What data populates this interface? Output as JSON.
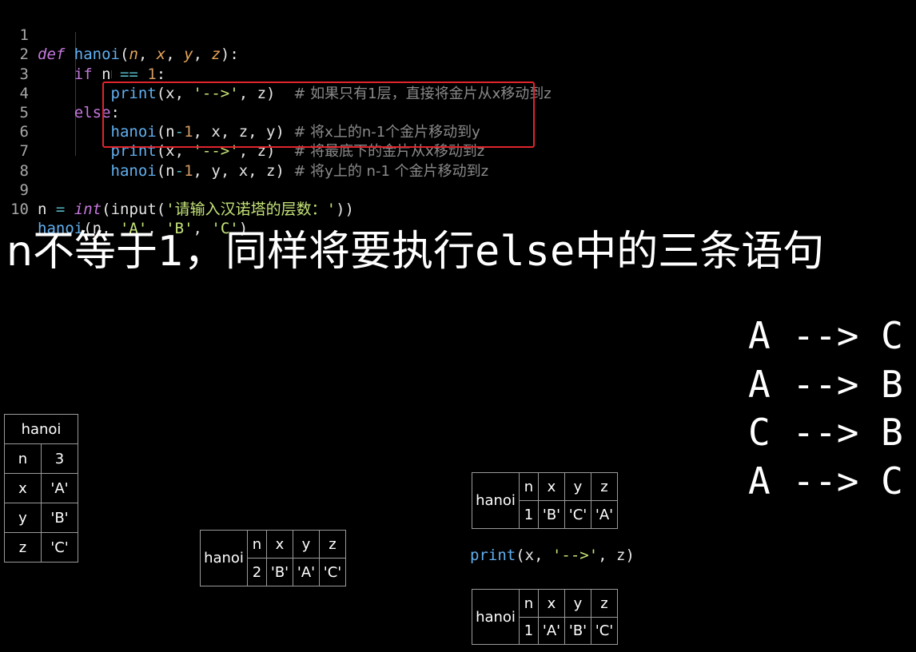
{
  "code": {
    "line_numbers": [
      "1",
      "2",
      "3",
      "4",
      "5",
      "6",
      "7",
      "8",
      "9",
      "10"
    ],
    "l1": {
      "kw": "def",
      "fn": "hanoi",
      "open": "(",
      "p_n": "n",
      "c1": ", ",
      "p_x": "x",
      "c2": ", ",
      "p_y": "y",
      "c3": ", ",
      "p_z": "z",
      "close": "):"
    },
    "l2": {
      "kw": "if",
      "sp1": " n ",
      "op": "==",
      "sp2": " ",
      "num": "1",
      "colon": ":"
    },
    "l3": {
      "fn": "print",
      "args_a": "(x, ",
      "str": "'-->'",
      "args_b": ", z)  ",
      "comment": "# 如果只有1层，直接将金片从x移动到z"
    },
    "l4": {
      "kw": "else",
      "colon": ":"
    },
    "l5": {
      "fn": "hanoi",
      "a": "(n",
      "op": "-",
      "num": "1",
      "b": ", x, z, y) ",
      "comment": "# 将x上的n-1个金片移动到y"
    },
    "l6": {
      "fn": "print",
      "a": "(x, ",
      "str": "'-->'",
      "b": ", z)  ",
      "comment": "# 将最底下的金片从x移动到z"
    },
    "l7": {
      "fn": "hanoi",
      "a": "(n",
      "op": "-",
      "num": "1",
      "b": ", y, x, z) ",
      "comment": "# 将y上的 n-1 个金片移动到z"
    },
    "l9": {
      "a": "n ",
      "op": "=",
      "b": " ",
      "int": "int",
      "c": "(input(",
      "str": "'请输入汉诺塔的层数：'",
      "d": "))"
    },
    "l10": {
      "fn": "hanoi",
      "a": "(n, ",
      "s1": "'A'",
      "c1": ", ",
      "s2": "'B'",
      "c2": ", ",
      "s3": "'C'",
      "d": ")"
    }
  },
  "headline": {
    "a": "n不等于1，同样将要执行",
    "b": "else",
    "c": "中的三条语句"
  },
  "moves": [
    "A --> C",
    "A --> B",
    "C --> B",
    "A --> C"
  ],
  "frame_main": {
    "title": "hanoi",
    "rows": [
      [
        "n",
        "3"
      ],
      [
        "x",
        "'A'"
      ],
      [
        "y",
        "'B'"
      ],
      [
        "z",
        "'C'"
      ]
    ]
  },
  "frame_mid": {
    "title": "hanoi",
    "headers": [
      "n",
      "x",
      "y",
      "z"
    ],
    "values": [
      "2",
      "'B'",
      "'A'",
      "'C'"
    ]
  },
  "frame_top": {
    "title": "hanoi",
    "headers": [
      "n",
      "x",
      "y",
      "z"
    ],
    "values": [
      "1",
      "'B'",
      "'C'",
      "'A'"
    ]
  },
  "frame_bottom": {
    "title": "hanoi",
    "headers": [
      "n",
      "x",
      "y",
      "z"
    ],
    "values": [
      "1",
      "'A'",
      "'B'",
      "'C'"
    ]
  },
  "print_call": {
    "fn": "print",
    "a": "(x, ",
    "str": "'-->'",
    "b": ", z)"
  }
}
